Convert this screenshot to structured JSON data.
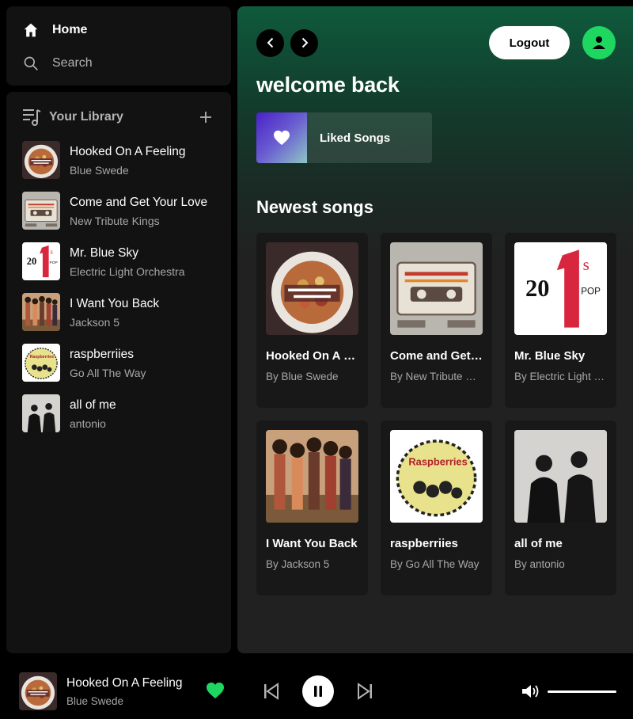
{
  "nav": {
    "home_label": "Home",
    "search_label": "Search"
  },
  "library": {
    "title": "Your Library",
    "items": [
      {
        "title": "Hooked On A Feeling",
        "artist": "Blue Swede"
      },
      {
        "title": "Come and Get Your Love",
        "artist": "New Tribute Kings"
      },
      {
        "title": "Mr. Blue Sky",
        "artist": "Electric Light Orchestra"
      },
      {
        "title": "I Want You Back",
        "artist": "Jackson 5"
      },
      {
        "title": "raspberriies",
        "artist": "Go All The Way"
      },
      {
        "title": "all of me",
        "artist": "antonio"
      }
    ]
  },
  "main": {
    "logout_label": "Logout",
    "welcome": "welcome back",
    "liked_songs_label": "Liked Songs",
    "section_title": "Newest songs",
    "cards": [
      {
        "title": "Hooked On A Feeling",
        "subtitle": "By Blue Swede"
      },
      {
        "title": "Come and Get Your Love",
        "subtitle": "By New Tribute Kings"
      },
      {
        "title": "Mr. Blue Sky",
        "subtitle": "By Electric Light Orchestra"
      },
      {
        "title": "I Want You Back",
        "subtitle": "By Jackson 5"
      },
      {
        "title": "raspberriies",
        "subtitle": "By Go All The Way"
      },
      {
        "title": "all of me",
        "subtitle": "By antonio"
      }
    ]
  },
  "player": {
    "title": "Hooked On A Feeling",
    "artist": "Blue Swede",
    "volume": 1.0
  },
  "colors": {
    "accent": "#1ed760",
    "panel": "#121212",
    "card": "#181818"
  }
}
